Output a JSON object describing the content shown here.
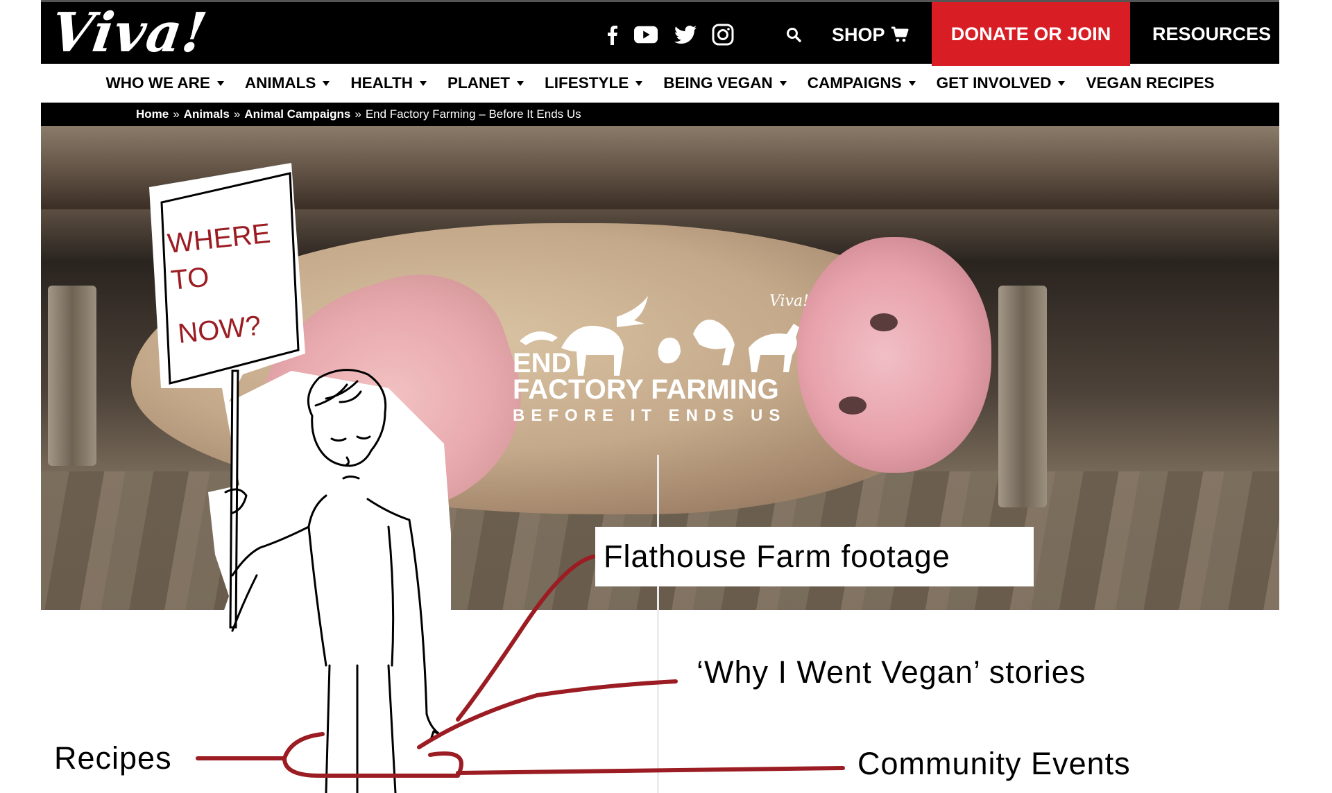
{
  "brand": {
    "logo_text": "Viva!",
    "accent": "#d81d25"
  },
  "header": {
    "social_icons": [
      "facebook-icon",
      "youtube-icon",
      "twitter-icon",
      "instagram-icon"
    ],
    "search_icon": "search-icon",
    "shop_label": "SHOP",
    "cart_icon": "cart-icon",
    "donate_label": "DONATE OR JOIN",
    "resources_label": "RESOURCES"
  },
  "nav": {
    "items": [
      {
        "label": "WHO WE ARE",
        "dropdown": true
      },
      {
        "label": "ANIMALS",
        "dropdown": true
      },
      {
        "label": "HEALTH",
        "dropdown": true
      },
      {
        "label": "PLANET",
        "dropdown": true
      },
      {
        "label": "LIFESTYLE",
        "dropdown": true
      },
      {
        "label": "BEING VEGAN",
        "dropdown": true
      },
      {
        "label": "CAMPAIGNS",
        "dropdown": true
      },
      {
        "label": "GET INVOLVED",
        "dropdown": true
      },
      {
        "label": "VEGAN RECIPES",
        "dropdown": false
      }
    ]
  },
  "breadcrumb": {
    "items": [
      "Home",
      "Animals",
      "Animal Campaigns"
    ],
    "separator": "»",
    "current": "End Factory Farming – Before It Ends Us"
  },
  "hero": {
    "campaign_line1": "END",
    "campaign_line2": "FACTORY FARMING",
    "campaign_line3": "BEFORE IT ENDS US",
    "campaign_signature": "Viva!"
  },
  "sketch": {
    "sign_line1": "WHERE",
    "sign_line2": "TO",
    "sign_line3": "NOW?",
    "ink_color": "#9b1c22"
  },
  "annotations": {
    "flathouse": "Flathouse Farm footage",
    "why_vegan": "‘Why I Went Vegan’ stories",
    "recipes": "Recipes",
    "community": "Community Events"
  }
}
